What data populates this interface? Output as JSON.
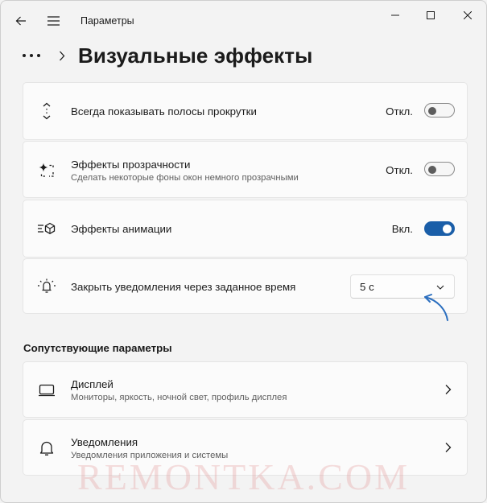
{
  "window": {
    "title": "Параметры"
  },
  "breadcrumb": {
    "page_title": "Визуальные эффекты"
  },
  "settings": [
    {
      "label": "Всегда показывать полосы прокрутки",
      "state": "Откл.",
      "on": false,
      "icon": "scrollbar-icon"
    },
    {
      "label": "Эффекты прозрачности",
      "sub": "Сделать некоторые фоны окон немного прозрачными",
      "state": "Откл.",
      "on": false,
      "icon": "transparency-icon"
    },
    {
      "label": "Эффекты анимации",
      "state": "Вкл.",
      "on": true,
      "icon": "animation-icon"
    },
    {
      "label": "Закрыть уведомления через заданное время",
      "dropdown_value": "5 с",
      "icon": "notification-timer-icon"
    }
  ],
  "related": {
    "title": "Сопутствующие параметры",
    "items": [
      {
        "label": "Дисплей",
        "sub": "Мониторы, яркость, ночной свет, профиль дисплея",
        "icon": "display-icon"
      },
      {
        "label": "Уведомления",
        "sub": "Уведомления приложения и системы",
        "icon": "bell-icon"
      }
    ]
  },
  "watermark": "REMONTKA.COM",
  "colors": {
    "accent": "#1a5ea8",
    "background": "#f3f3f3",
    "card": "#fbfbfb"
  }
}
